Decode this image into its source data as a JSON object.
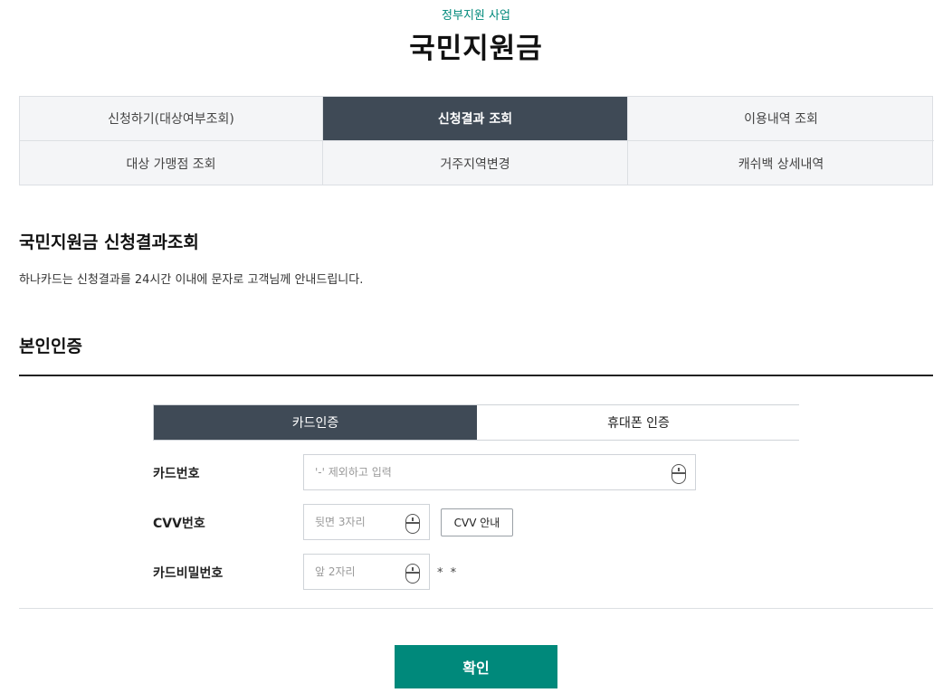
{
  "header": {
    "eyebrow": "정부지원 사업",
    "title": "국민지원금"
  },
  "menu": {
    "items": [
      {
        "label": "신청하기(대상여부조회)",
        "active": false
      },
      {
        "label": "신청결과 조회",
        "active": true
      },
      {
        "label": "이용내역 조회",
        "active": false
      },
      {
        "label": "대상 가맹점 조회",
        "active": false
      },
      {
        "label": "거주지역변경",
        "active": false
      },
      {
        "label": "캐쉬백 상세내역",
        "active": false
      }
    ]
  },
  "section": {
    "title": "국민지원금 신청결과조회",
    "description": "하나카드는 신청결과를 24시간 이내에 문자로 고객님께 안내드립니다."
  },
  "auth": {
    "title": "본인인증",
    "tabs": [
      {
        "label": "카드인증",
        "active": true
      },
      {
        "label": "휴대폰 인증",
        "active": false
      }
    ],
    "fields": {
      "card_number": {
        "label": "카드번호",
        "placeholder": "'-' 제외하고 입력",
        "value": ""
      },
      "cvv": {
        "label": "CVV번호",
        "placeholder": "뒷면 3자리",
        "value": "",
        "help_button": "CVV 안내"
      },
      "card_password": {
        "label": "카드비밀번호",
        "placeholder": "앞 2자리",
        "value": "",
        "mask": "* *"
      }
    },
    "input_icon": "mouse-icon"
  },
  "actions": {
    "confirm_label": "확인"
  },
  "colors": {
    "accent": "#00897b",
    "active_tab": "#3f4a56",
    "menu_bg": "#f4f5f7"
  }
}
